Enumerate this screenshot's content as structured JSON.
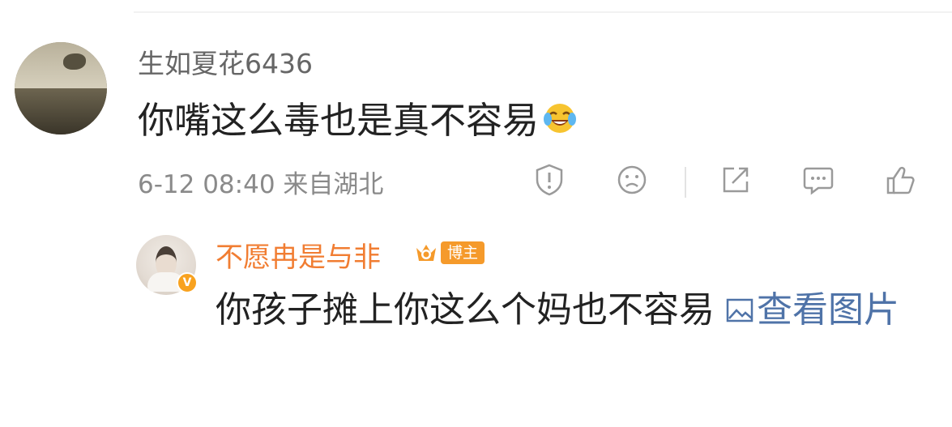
{
  "thread": {
    "main_comment": {
      "username": "生如夏花6436",
      "text": "你嘴这么毒也是真不容易",
      "emoji": "laughing-tears-icon",
      "meta": "6-12 08:40 来自湖北",
      "actions": [
        "report-icon",
        "dislike-icon",
        "share-icon",
        "comment-icon",
        "like-icon"
      ]
    },
    "reply": {
      "username": "不愿冉是与非",
      "author_badge": "博主",
      "text": "你孩子摊上你这么个妈也不容易",
      "view_image_label": "查看图片",
      "verified_mark": "V"
    }
  },
  "colors": {
    "username_main": "#666666",
    "username_reply": "#f17d32",
    "link": "#4f73a8",
    "meta": "#8a8a8a",
    "badge": "#f59a2b"
  }
}
